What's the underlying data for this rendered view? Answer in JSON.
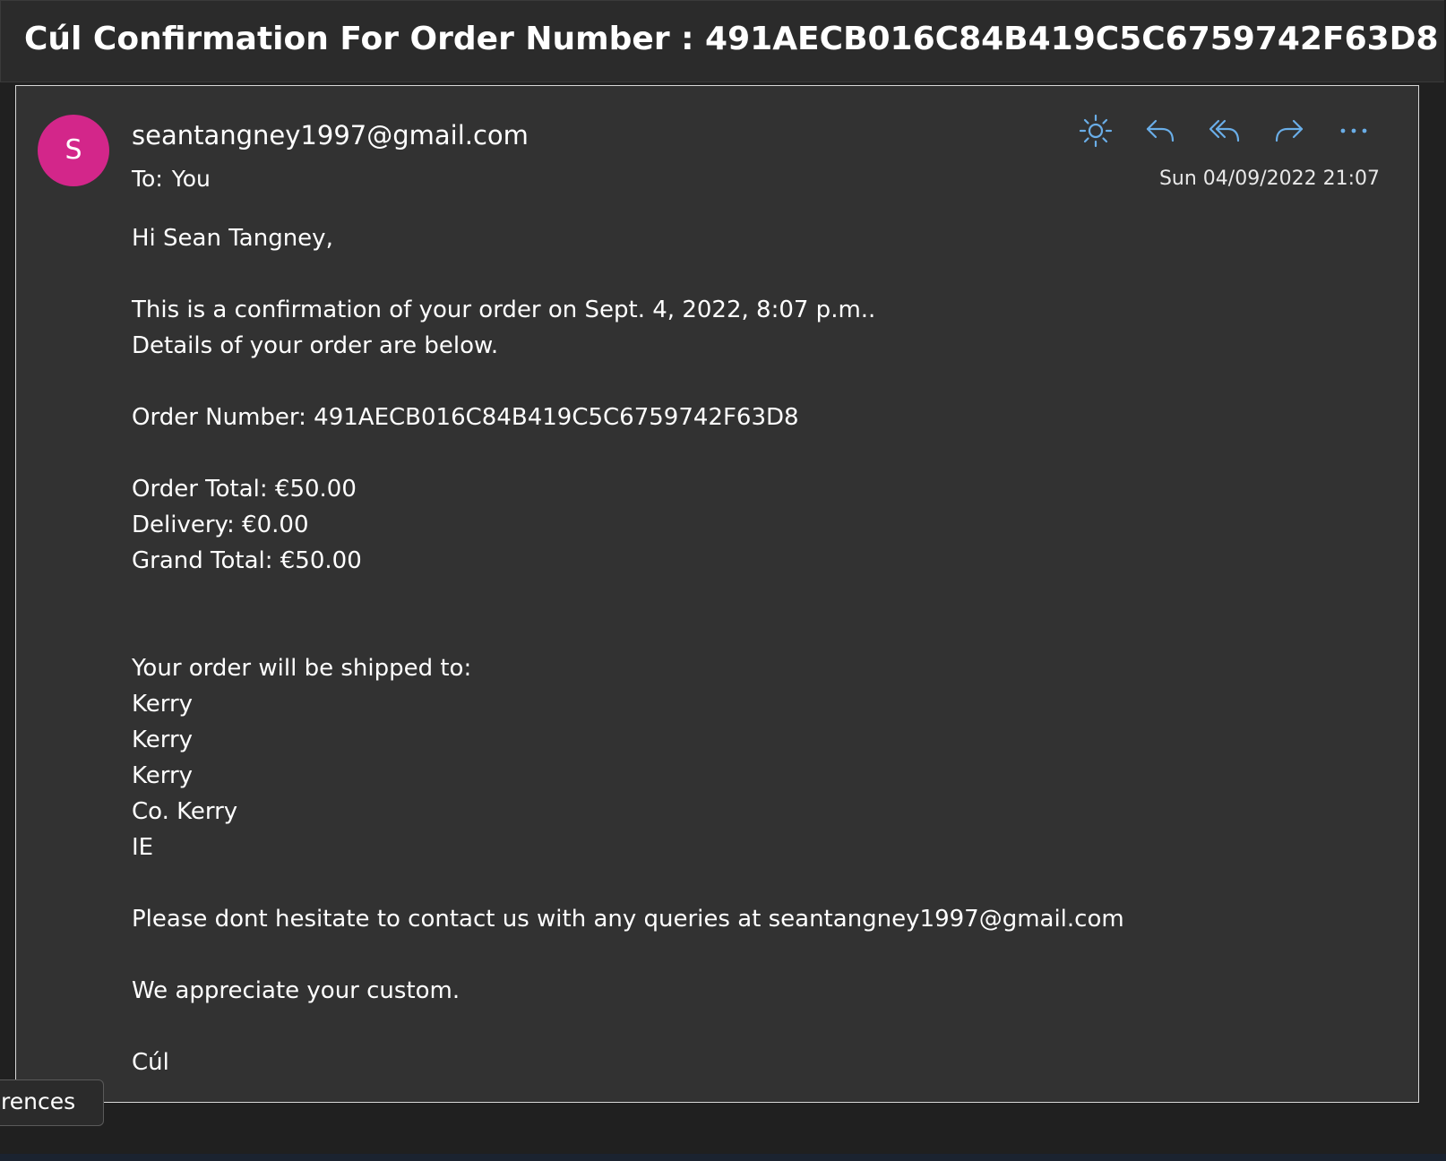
{
  "email": {
    "subject": "Cúl Confirmation For Order Number : 491AECB016C84B419C5C6759742F63D8",
    "avatar_initial": "S",
    "avatar_color": "#d3268a",
    "sender": "seantangney1997@gmail.com",
    "to_label": "To:",
    "to_value": "You",
    "date": "Sun 04/09/2022 21:07",
    "actions": [
      {
        "name": "sun-icon",
        "label": "Light mode"
      },
      {
        "name": "reply-icon",
        "label": "Reply"
      },
      {
        "name": "reply-all-icon",
        "label": "Reply all"
      },
      {
        "name": "forward-icon",
        "label": "Forward"
      },
      {
        "name": "more-icon",
        "label": "More actions"
      }
    ],
    "body": {
      "greeting": "Hi Sean Tangney,",
      "confirmation_line": "This is a confirmation of your order on Sept. 4, 2022, 8:07 p.m..",
      "details_line": "Details of your order are below.",
      "order_number_line": "Order Number: 491AECB016C84B419C5C6759742F63D8",
      "order_total": "Order Total: €50.00",
      "delivery": "Delivery: €0.00",
      "grand_total": "Grand Total: €50.00",
      "ship_to_heading": "Your order will be shipped to:",
      "address": [
        "Kerry",
        "Kerry",
        "Kerry",
        "Co. Kerry",
        "IE"
      ],
      "contact_line": "Please dont hesitate to contact us with any queries at seantangney1997@gmail.com",
      "appreciation": "We appreciate your custom.",
      "signature": "Cúl"
    }
  },
  "preferences_tab": {
    "label": "rences"
  },
  "colors": {
    "accent_icon": "#6aaee8",
    "card_bg": "#323232",
    "app_bg": "#202020"
  }
}
